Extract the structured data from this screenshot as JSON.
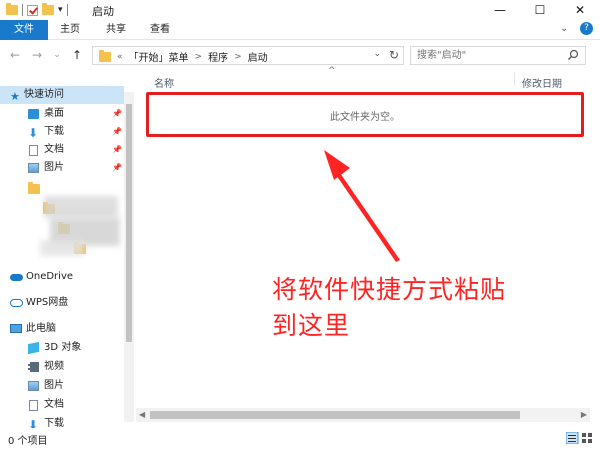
{
  "window": {
    "title": "启动",
    "controls": {
      "minimize": "—",
      "maximize": "☐",
      "close": "✕"
    }
  },
  "ribbon": {
    "tabs": [
      "文件",
      "主页",
      "共享",
      "查看"
    ],
    "expand": "⌄",
    "help": "?"
  },
  "nav": {
    "back": "←",
    "forward": "→",
    "recent": "⌄",
    "up": "↑"
  },
  "address": {
    "overflow": "«",
    "crumbs": [
      "「开始」菜单",
      "程序",
      "启动"
    ],
    "dropdown": "⌄",
    "refresh": "↻"
  },
  "search": {
    "placeholder": "搜索\"启动\""
  },
  "sidebar": {
    "quick_access": "快速访问",
    "pinned": [
      {
        "label": "桌面",
        "icon": "desktop-icon"
      },
      {
        "label": "下载",
        "icon": "download-icon"
      },
      {
        "label": "文档",
        "icon": "documents-icon"
      },
      {
        "label": "图片",
        "icon": "pictures-icon"
      }
    ],
    "pin_glyph": "📌",
    "onedrive": "OneDrive",
    "wps": "WPS网盘",
    "this_pc": "此电脑",
    "pc_items": [
      {
        "label": "3D 对象",
        "icon": "cube-icon"
      },
      {
        "label": "视频",
        "icon": "video-icon"
      },
      {
        "label": "图片",
        "icon": "pictures-icon"
      },
      {
        "label": "文档",
        "icon": "documents-icon"
      },
      {
        "label": "下载",
        "icon": "download-icon"
      }
    ]
  },
  "columns": {
    "name": "名称",
    "date": "修改日期",
    "sort": "^"
  },
  "main": {
    "empty_message": "此文件夹为空。"
  },
  "annotation": {
    "line1": "将软件快捷方式粘贴",
    "line2": "到这里"
  },
  "status": {
    "text": "0 个项目"
  },
  "colors": {
    "accent": "#1979ca",
    "annotation": "#ff2424",
    "folder": "#f2c14e"
  }
}
